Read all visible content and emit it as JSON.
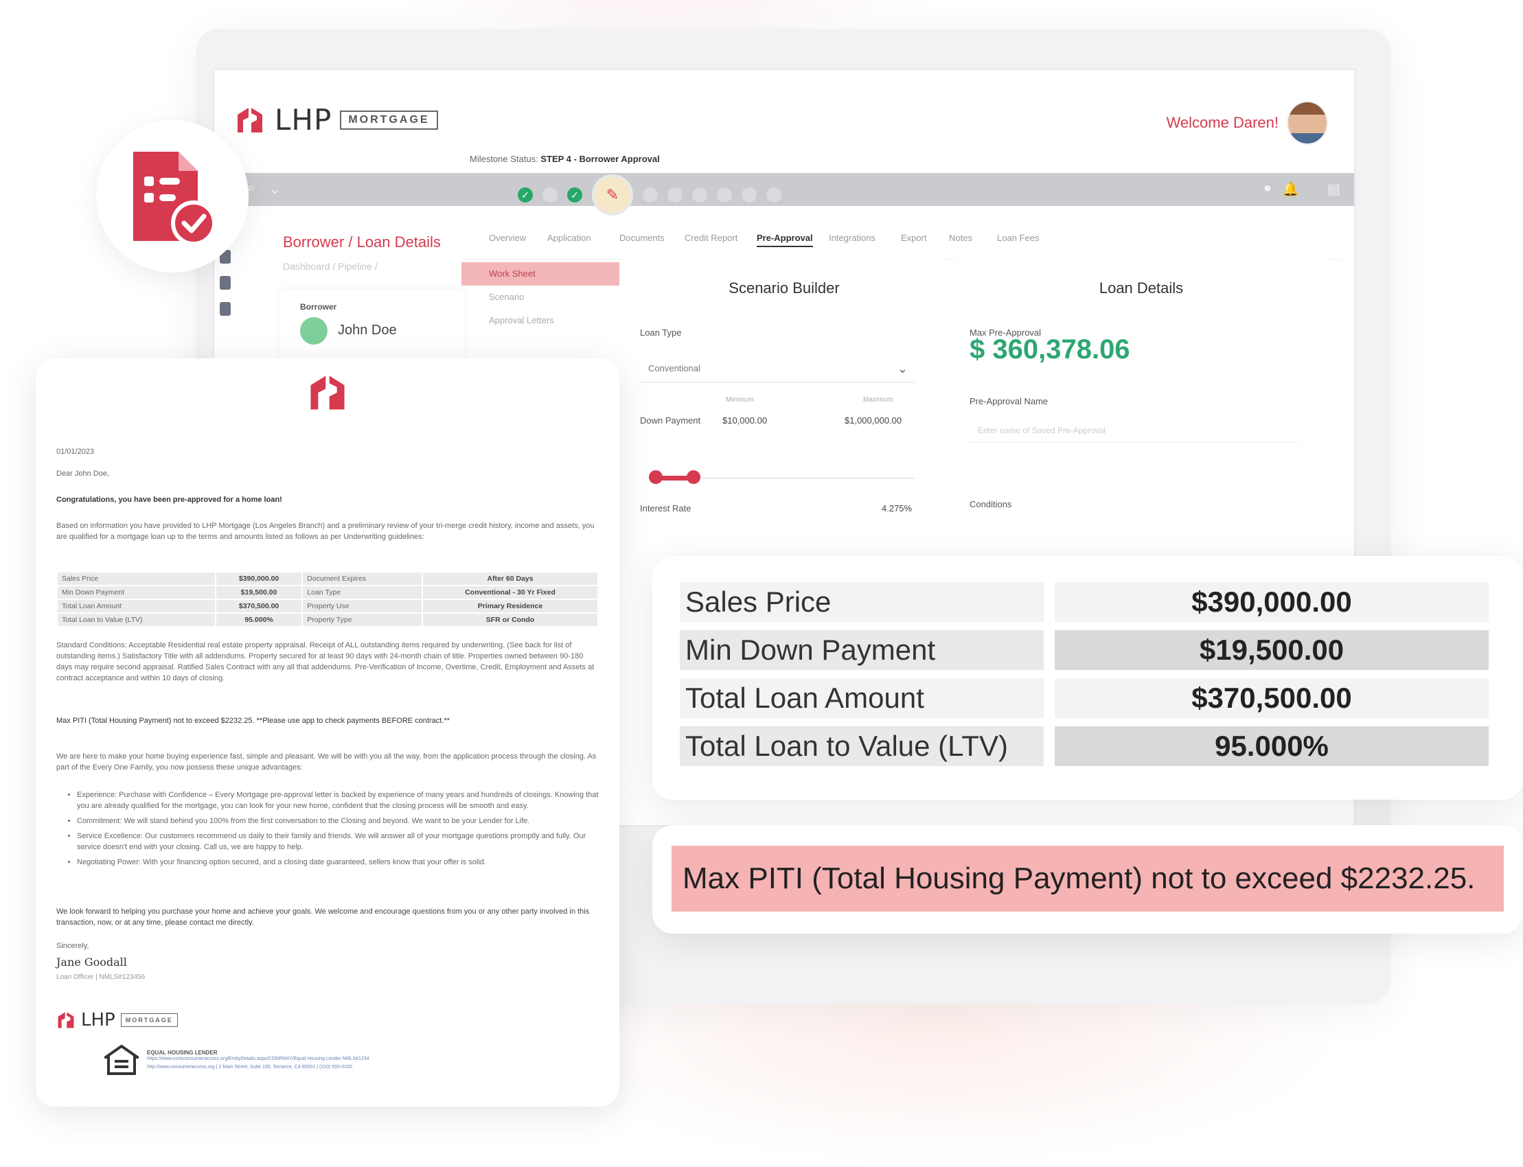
{
  "brand": {
    "name": "LHP",
    "badge": "MORTGAGE",
    "accent_color": "#d63a4f",
    "green_color": "#2da673"
  },
  "header": {
    "welcome": "Welcome Daren!"
  },
  "page": {
    "title": "Borrower / Loan Details",
    "milestone_label": "Milestone Status:",
    "milestone_value": "STEP 4 - Borrower Approval"
  },
  "borrower": {
    "label": "Borrower",
    "name": "John Doe"
  },
  "tabs": [
    "Overview",
    "Application",
    "Documents",
    "Credit Report",
    "Pre-Approval",
    "Integrations",
    "Export",
    "Notes",
    "Loan Fees"
  ],
  "left_menu": [
    "Work Sheet",
    "Scenario",
    "Approval Letters"
  ],
  "scenario_builder": {
    "title": "Scenario Builder",
    "loan_type_label": "Loan Type",
    "loan_type_value": "Conventional",
    "minimum_label": "Minimum",
    "maximum_label": "Maximum",
    "down_payment_label": "Down Payment",
    "down_min": "$10,000.00",
    "down_max": "$1,000,000.00",
    "interest_label": "Interest Rate",
    "interest_value": "4.275%"
  },
  "loan_details": {
    "title": "Loan Details",
    "max_label": "Max Pre-Approval",
    "max_value": "$ 360,378.06",
    "name_label": "Pre-Approval Name",
    "name_placeholder": "Enter name of Saved Pre-Approval",
    "conditions_label": "Conditions"
  },
  "letter": {
    "date": "01/01/2023",
    "greeting": "Dear John Doe,",
    "congrats": "Congratulations, you have been pre-approved for a home loan!",
    "intro": "Based on information you have provided to LHP Mortgage (Los Angeles Branch) and a preliminary review of your tri-merge credit history, income and assets, you are qualified for a mortgage loan up to the terms and amounts listed as follows as per Underwriting guidelines:",
    "table": [
      [
        "Sales Price",
        "$390,000.00",
        "Document Expires",
        "After 60 Days"
      ],
      [
        "Min Down Payment",
        "$19,500.00",
        "Loan Type",
        "Conventional - 30 Yr Fixed"
      ],
      [
        "Total Loan Amount",
        "$370,500.00",
        "Property Use",
        "Primary Residence"
      ],
      [
        "Total Loan to Value (LTV)",
        "95.000%",
        "Property Type",
        "SFR or Condo"
      ]
    ],
    "conditions": "Standard Conditions: Acceptable Residential real estate property appraisal. Receipt of ALL outstanding items required by underwriting. (See back for list of outstanding items.) Satisfactory Title with all addendums. Property secured for at least 90 days with 24-month chain of title. Properties owned between 90-180 days may require second appraisal. Ratified Sales Contract with any all that addendums. Pre-Verification of Income, Overtime, Credit, Employment and Assets at contract acceptance and within 10 days of closing.",
    "piti": "Max PITI (Total Housing Payment) not to exceed $2232.25.  **Please use app to check payments BEFORE contract.**",
    "para2": "We are here to make your home buying experience fast, simple and pleasant. We will be with you all the way, from the application process through the closing. As part of the Every One Family, you now possess these unique advantages:",
    "bullets": [
      "Experience: Purchase with Confidence – Every Mortgage pre-approval letter is backed by experience of many years and hundreds of closings. Knowing that you are already qualified for the mortgage, you can look for your new home, confident that the closing process will be smooth and easy.",
      "Commitment: We will stand behind you 100% from the first conversation to the Closing and beyond. We want to be your Lender for Life.",
      "Service Excellence: Our customers recommend us daily to their family and friends. We will answer all of your mortgage questions promptly and fully. Our service doesn't end with your closing. Call us, we are happy to help.",
      "Negotiating Power: With your financing option secured, and a closing date guaranteed, sellers know that your offer is solid."
    ],
    "closing_para": "We look forward to helping you purchase your home and achieve your goals. We welcome and encourage questions from you or any other party involved in this transaction, now, or at any time, please contact me directly.",
    "sincerely": "Sincerely,",
    "signer": "Jane Goodall",
    "signer_title": "Loan Officer | NMLS#123456",
    "ehl_title": "EQUAL HOUSING LENDER",
    "ehl_line1": "https://www.nmlsconsumeraccess.org/EntityDetails.aspx/COMPANY/Equal Housing Lender NMLS#1234",
    "ehl_line2": "http://www.consumeraccess.org  |  2 Main Street, Suite 100, Torrance, CA 90501  |  (310) 555-0100"
  },
  "summary": [
    {
      "label": "Sales Price",
      "value": "$390,000.00"
    },
    {
      "label": "Min Down Payment",
      "value": "$19,500.00"
    },
    {
      "label": "Total Loan Amount",
      "value": "$370,500.00"
    },
    {
      "label": "Total Loan to Value (LTV)",
      "value": "95.000%"
    }
  ],
  "piti_banner": "Max PITI (Total Housing Payment) not to exceed $2232.25."
}
